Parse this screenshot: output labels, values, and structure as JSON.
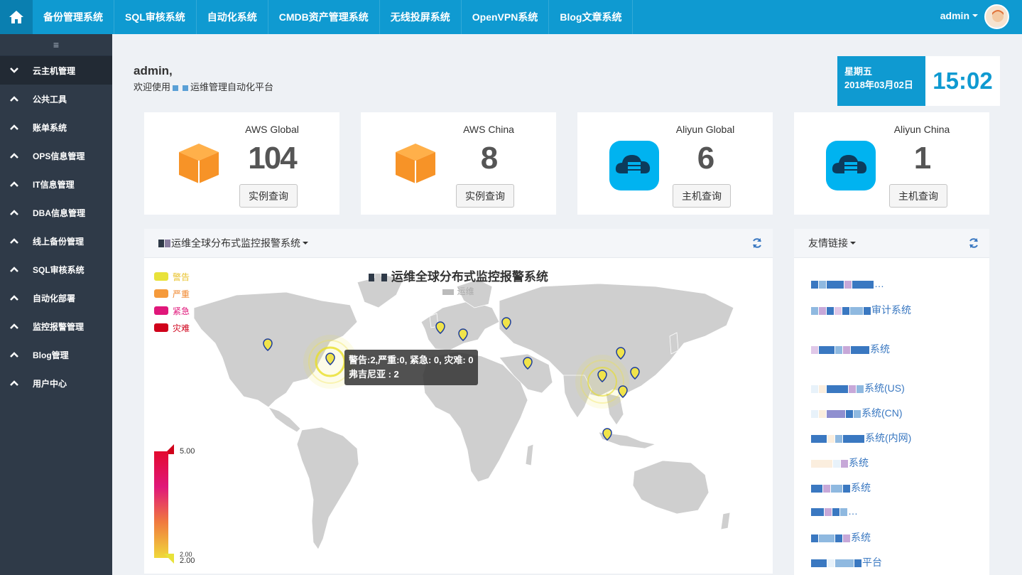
{
  "nav": {
    "items": [
      "备份管理系统",
      "SQL审核系统",
      "自动化系统",
      "CMDB资产管理系统",
      "无线投屏系统",
      "OpenVPN系统",
      "Blog文章系统"
    ],
    "user": "admin"
  },
  "sidebar": {
    "toggle": "≡",
    "items": [
      {
        "label": "云主机管理",
        "expanded": true
      },
      {
        "label": "公共工具"
      },
      {
        "label": "账单系统"
      },
      {
        "label": "OPS信息管理"
      },
      {
        "label": "IT信息管理"
      },
      {
        "label": "DBA信息管理"
      },
      {
        "label": "线上备份管理"
      },
      {
        "label": "SQL审核系统"
      },
      {
        "label": "自动化部署"
      },
      {
        "label": "监控报警管理"
      },
      {
        "label": "Blog管理"
      },
      {
        "label": "用户中心"
      }
    ]
  },
  "welcome": {
    "name": "admin,",
    "prefix": "欢迎使用",
    "suffix": "运维管理自动化平台"
  },
  "date": {
    "weekday": "星期五",
    "date": "2018年03月02日",
    "time": "15:02"
  },
  "cards": [
    {
      "title": "AWS Global",
      "count": "104",
      "button": "实例查询",
      "icon": "aws-box-icon"
    },
    {
      "title": "AWS China",
      "count": "8",
      "button": "实例查询",
      "icon": "aws-box-icon"
    },
    {
      "title": "Aliyun Global",
      "count": "6",
      "button": "主机查询",
      "icon": "cloud-server-icon"
    },
    {
      "title": "Aliyun China",
      "count": "1",
      "button": "主机查询",
      "icon": "cloud-server-icon"
    }
  ],
  "monitor_panel": {
    "header": "运维全球分布式监控报警系统",
    "map_title": "运维全球分布式监控报警系统",
    "map_subtitle": "运维",
    "legend": [
      {
        "label": "警告",
        "color": "#e8e23a"
      },
      {
        "label": "严重",
        "color": "#f59a3b"
      },
      {
        "label": "紧急",
        "color": "#e0177a"
      },
      {
        "label": "灾难",
        "color": "#d0021b"
      }
    ],
    "tooltip_line1": "警告:2,严重:0, 紧急: 0, 灾难: 0",
    "tooltip_line2": "弗吉尼亚 : 2",
    "visual_map": {
      "max": "5.00",
      "min": "2.00",
      "min_label": "2.00"
    }
  },
  "links_panel": {
    "header": "友情链接",
    "links": [
      "…",
      "审计系统",
      "系统",
      "系统(US)",
      "系统(CN)",
      "系统(内网)",
      "系统",
      "系统",
      "…",
      "系统",
      "平台"
    ]
  },
  "colors": {
    "primary": "#0f9ad1",
    "sidebar": "#2f3a48",
    "link": "#3a78c1"
  }
}
